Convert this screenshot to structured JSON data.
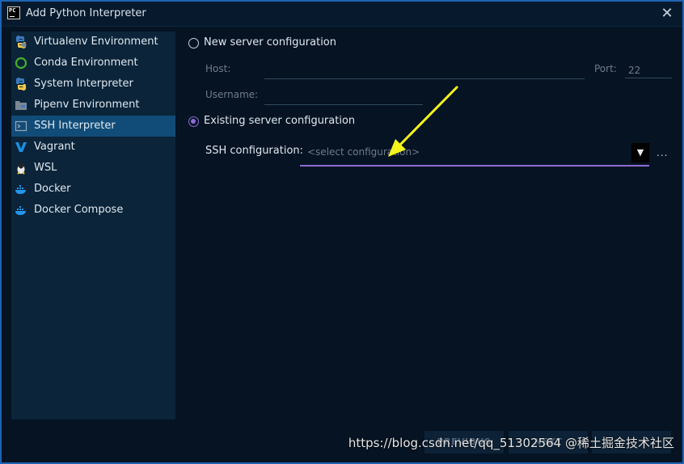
{
  "window": {
    "title": "Add Python Interpreter",
    "close_glyph": "✕",
    "app_icon_label": "PC"
  },
  "sidebar": {
    "items": [
      {
        "label": "Virtualenv Environment",
        "icon": "python-venv-icon"
      },
      {
        "label": "Conda Environment",
        "icon": "conda-icon"
      },
      {
        "label": "System Interpreter",
        "icon": "python-icon"
      },
      {
        "label": "Pipenv Environment",
        "icon": "pipenv-icon"
      },
      {
        "label": "SSH Interpreter",
        "icon": "ssh-icon",
        "selected": true
      },
      {
        "label": "Vagrant",
        "icon": "vagrant-icon"
      },
      {
        "label": "WSL",
        "icon": "linux-penguin-icon"
      },
      {
        "label": "Docker",
        "icon": "docker-icon"
      },
      {
        "label": "Docker Compose",
        "icon": "docker-compose-icon"
      }
    ]
  },
  "main": {
    "new_server": {
      "label": "New server configuration",
      "selected": false,
      "host_label": "Host:",
      "host_value": "",
      "port_label": "Port:",
      "port_value": "22",
      "username_label": "Username:",
      "username_value": ""
    },
    "existing_server": {
      "label": "Existing server configuration",
      "selected": true,
      "ssh_config_label": "SSH configuration:",
      "ssh_config_placeholder": "<select configuration>",
      "more_label": "..."
    }
  },
  "footer": {
    "previous_label": "PREVIOUS",
    "next_label": "NEXT"
  },
  "watermark": "https://blog.csdn.net/qq_51302564 @稀土掘金技术社区",
  "colors": {
    "accent": "#8f6bd6",
    "selected_bg": "#114c78",
    "arrow": "#f5f51a"
  }
}
